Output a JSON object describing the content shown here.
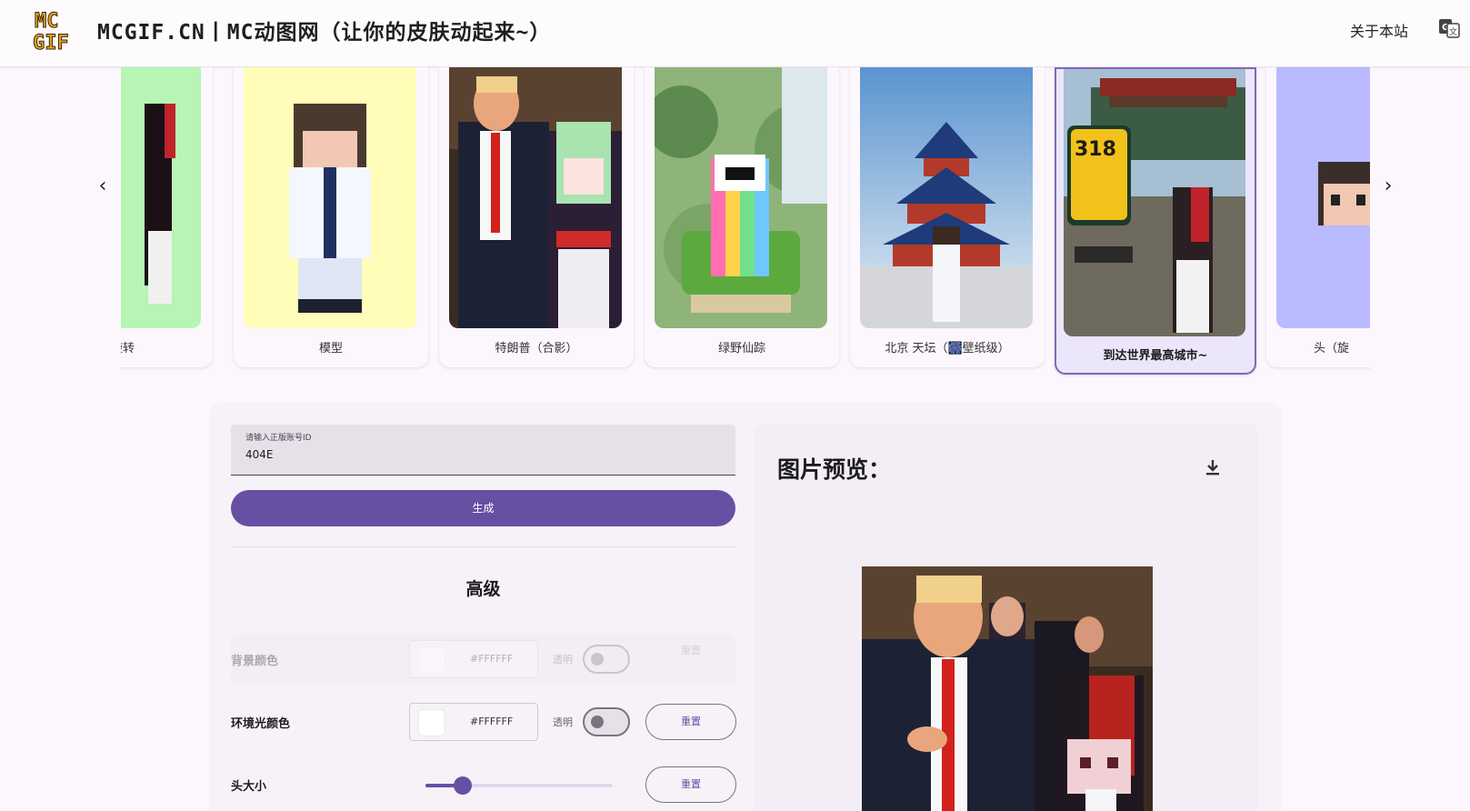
{
  "header": {
    "title": "MCGIF.CN丨MC动图网（让你的皮肤动起来~）",
    "about": "关于本站",
    "logo_text": "MC GIF"
  },
  "carousel": {
    "items": [
      {
        "label": "旋转",
        "bg": "#b6f5b4"
      },
      {
        "label": "模型",
        "bg": "#fffdb8"
      },
      {
        "label": "特朗普（合影）",
        "bg": "#3a2b20"
      },
      {
        "label": "绿野仙踪",
        "bg": "#9fc48a"
      },
      {
        "label": "北京 天坛（🎆壁纸级）",
        "bg": "#9ec4e6"
      },
      {
        "label": "到达世界最高城市~",
        "bg": "#7a8f6a"
      },
      {
        "label": "头（旋",
        "bg": "#b9baff"
      }
    ],
    "selected_index": 5
  },
  "form": {
    "id_label": "请输入正版账号ID",
    "id_value": "404E",
    "generate": "生成",
    "advanced": "高级",
    "bg_color": {
      "label": "背景颜色",
      "hex": "#FFFFFF",
      "transparent": "透明",
      "reset": "重置"
    },
    "ambient": {
      "label": "环境光颜色",
      "hex": "#FFFFFF",
      "transparent": "透明",
      "reset": "重置"
    },
    "head_size": {
      "label": "头大小",
      "reset": "重置",
      "value": 0.2
    }
  },
  "preview": {
    "title": "图片预览："
  },
  "colors": {
    "accent": "#6750a4"
  }
}
